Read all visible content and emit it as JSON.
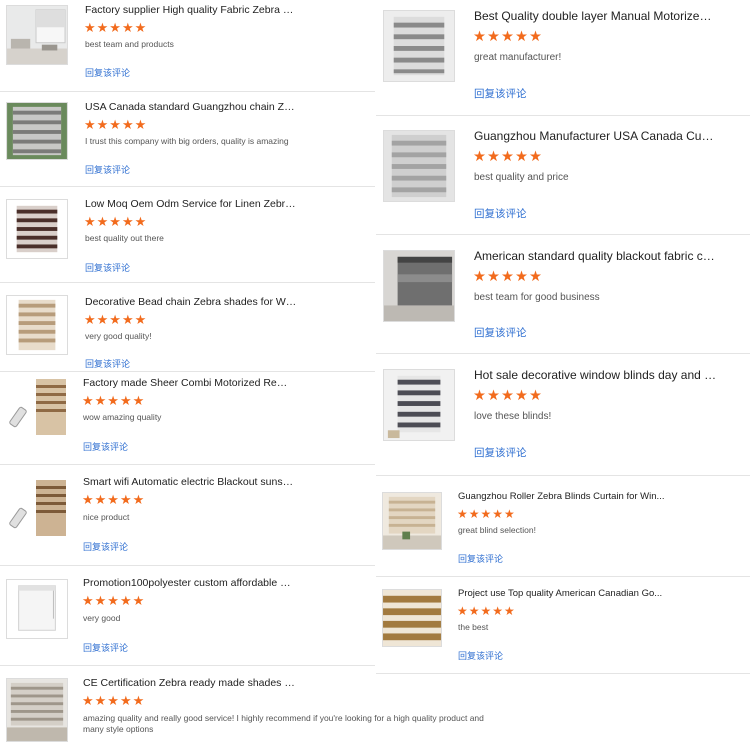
{
  "reply_label": "回复该评论",
  "star_glyph": "★★★★★",
  "colors": {
    "star": "#f26b1d",
    "link": "#2f6fd1",
    "divider": "#e4e4e4"
  },
  "left_reviews": [
    {
      "title": "Factory supplier High quality Fabric Zebra Roll...",
      "rating": 5,
      "comment": "best team and products",
      "thumb_icon": "room-with-roller-blind-icon"
    },
    {
      "title": "USA Canada standard Guangzhou chain Zebra ...",
      "rating": 5,
      "comment": "I trust this company with big orders, quality is amazing",
      "thumb_icon": "window-zebra-blind-icon"
    },
    {
      "title": "Low Moq Oem Odm Service for Linen Zebra Ro...",
      "rating": 5,
      "comment": "best quality out there",
      "thumb_icon": "dark-zebra-blind-icon"
    },
    {
      "title": "Decorative Bead chain Zebra shades for Windo...",
      "rating": 5,
      "comment": "very good quality!",
      "thumb_icon": "beige-zebra-blind-icon"
    },
    {
      "title": "Factory made Sheer Combi Motorized Remote ...",
      "rating": 5,
      "comment": "wow amazing quality",
      "thumb_icon": "blind-with-remote-icon"
    },
    {
      "title": "Smart wifi Automatic electric Blackout sunscre...",
      "rating": 5,
      "comment": "nice product",
      "thumb_icon": "blind-with-remote-icon"
    },
    {
      "title": "Promotion100polyester custom affordable curt...",
      "rating": 5,
      "comment": "very good",
      "thumb_icon": "white-roller-blind-icon"
    },
    {
      "title": "CE Certification Zebra ready made shades curt...",
      "rating": 5,
      "comment": "amazing quality and really good service! I highly recommend if you're looking for a high quality product and many style options",
      "thumb_icon": "sheer-blind-room-icon"
    }
  ],
  "right_reviews": [
    {
      "title": "Best Quality double layer Manual Motorized ze...",
      "rating": 5,
      "comment": "great manufacturer!",
      "thumb_icon": "grey-zebra-blind-icon"
    },
    {
      "title": "Guangzhou Manufacturer USA Canada Custom...",
      "rating": 5,
      "comment": "best quality and price",
      "thumb_icon": "light-grey-zebra-blind-icon"
    },
    {
      "title": "American standard quality blackout fabric cove...",
      "rating": 5,
      "comment": "best team for good business",
      "thumb_icon": "grey-blackout-blind-icon"
    },
    {
      "title": "Hot sale decorative window blinds day and nig...",
      "rating": 5,
      "comment": "love these blinds!",
      "thumb_icon": "dark-striped-blind-icon"
    },
    {
      "title": "Guangzhou Roller Zebra Blinds Curtain for Win...",
      "rating": 5,
      "comment": "great blind selection!",
      "thumb_icon": "blind-over-window-icon"
    },
    {
      "title": "Project use Top quality American Canadian Go...",
      "rating": 5,
      "comment": "the best",
      "thumb_icon": "wood-stripe-blind-icon"
    }
  ]
}
